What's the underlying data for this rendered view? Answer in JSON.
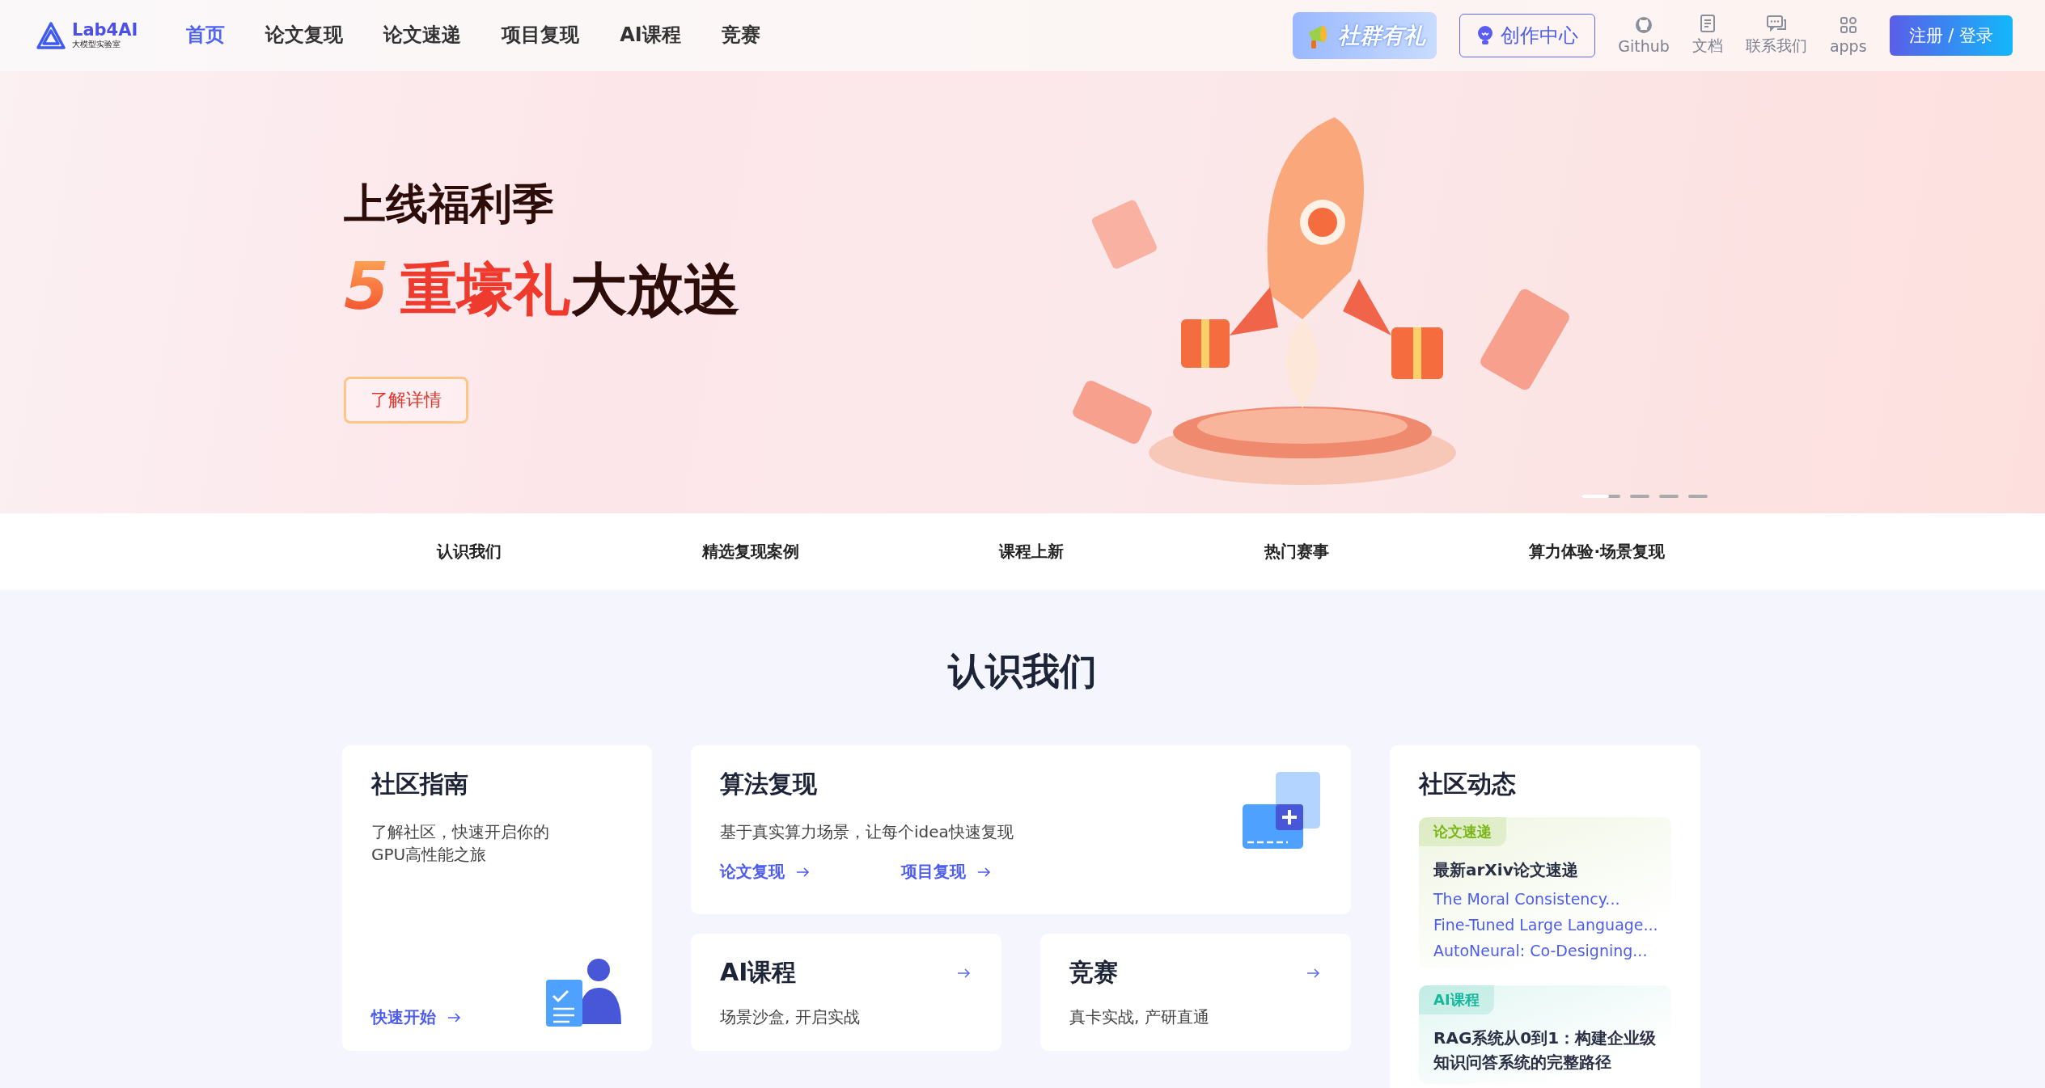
{
  "header": {
    "logo": {
      "name": "Lab4AI",
      "subtitle": "大模型实验室"
    },
    "nav": [
      {
        "label": "首页",
        "selected": true
      },
      {
        "label": "论文复现",
        "selected": false
      },
      {
        "label": "论文速递",
        "selected": false
      },
      {
        "label": "项目复现",
        "selected": false
      },
      {
        "label": "AI课程",
        "selected": false
      },
      {
        "label": "竞赛",
        "selected": false
      }
    ],
    "promo": "社群有礼",
    "create": "创作中心",
    "tools": [
      {
        "kind": "github",
        "label": "Github"
      },
      {
        "kind": "docs",
        "label": "文档"
      },
      {
        "kind": "contact",
        "label": "联系我们"
      },
      {
        "kind": "apps",
        "label": "apps"
      }
    ],
    "login": "注册 / 登录"
  },
  "hero": {
    "line1": "上线福利季",
    "line2": [
      {
        "kind": "number",
        "text": "5"
      },
      {
        "kind": "highlight",
        "text": "重壕礼"
      },
      {
        "kind": "plain",
        "text": "大放送"
      }
    ],
    "button": "了解详情",
    "slides": [
      {
        "selected": true
      },
      {
        "selected": false
      },
      {
        "selected": false
      },
      {
        "selected": false
      }
    ],
    "level": 0.7
  },
  "section_nav": [
    "认识我们",
    "精选复现案例",
    "课程上新",
    "热门赛事",
    "算力体验·场景复现"
  ],
  "section": {
    "title": "认识我们",
    "guide": {
      "title": "社区指南",
      "text": "了解社区，快速开启你的GPU高性能之旅",
      "link": "快速开始"
    },
    "algo": {
      "title": "算法复现",
      "text": "基于真实算力场景，让每个idea快速复现",
      "links": [
        "论文复现",
        "项目复现"
      ]
    },
    "small_cards": [
      {
        "title": "AI课程",
        "text": "场景沙盒, 开启实战"
      },
      {
        "title": "竞赛",
        "text": "真卡实战, 产研直通"
      }
    ],
    "news": {
      "title": "社区动态",
      "blocks": [
        {
          "tag": "论文速递",
          "color": "#7cb518",
          "title": "最新arXiv论文速递",
          "items": [
            "The Moral Consistency...",
            "Fine-Tuned Large Language...",
            "AutoNeural: Co-Designing..."
          ]
        },
        {
          "tag": "AI课程",
          "color": "#14b89a",
          "title": "RAG系统从0到1：构建企业级知识问答系统的完整路径"
        }
      ]
    }
  }
}
